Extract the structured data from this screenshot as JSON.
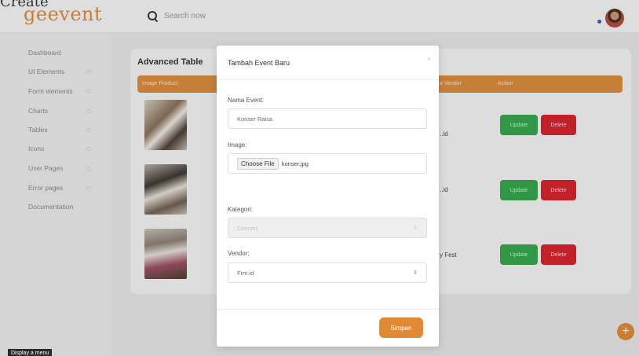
{
  "caption": "Create",
  "header": {
    "logo": "geevent",
    "search_placeholder": "Search now"
  },
  "sidebar": {
    "items": [
      {
        "label": "Dashboard",
        "has_caret": false
      },
      {
        "label": "UI Elements",
        "has_caret": true
      },
      {
        "label": "Form elements",
        "has_caret": true
      },
      {
        "label": "Charts",
        "has_caret": true
      },
      {
        "label": "Tables",
        "has_caret": true
      },
      {
        "label": "Icons",
        "has_caret": true
      },
      {
        "label": "User Pages",
        "has_caret": true
      },
      {
        "label": "Error pages",
        "has_caret": true
      },
      {
        "label": "Documentation",
        "has_caret": false
      }
    ],
    "caret_glyph": "◻"
  },
  "table": {
    "title": "Advanced Table",
    "columns": [
      "Image Product",
      "a Vendor",
      "Action"
    ],
    "rows": [
      {
        "vendor": "..id",
        "update": "Update",
        "delete": "Delete"
      },
      {
        "vendor": "..id",
        "update": "Update",
        "delete": "Delete"
      },
      {
        "vendor": "y Fest",
        "update": "Update",
        "delete": "Delete"
      }
    ]
  },
  "modal": {
    "title": "Tambah Event Baru",
    "close": "×",
    "fields": {
      "nama_label": "Nama Event:",
      "nama_value": "Konser Raisa",
      "image_label": "Image:",
      "file_button": "Choose File",
      "file_name": "konser.jpg",
      "kategori_label": "Kategori:",
      "kategori_value": "Concert",
      "vendor_label": "Vendor:",
      "vendor_value": "Frm.id"
    },
    "submit": "Simpan"
  },
  "fab": "+",
  "status_tooltip": "Display a menu",
  "colors": {
    "accent": "#e08a36",
    "update": "#33a74a",
    "delete": "#d8202a"
  }
}
